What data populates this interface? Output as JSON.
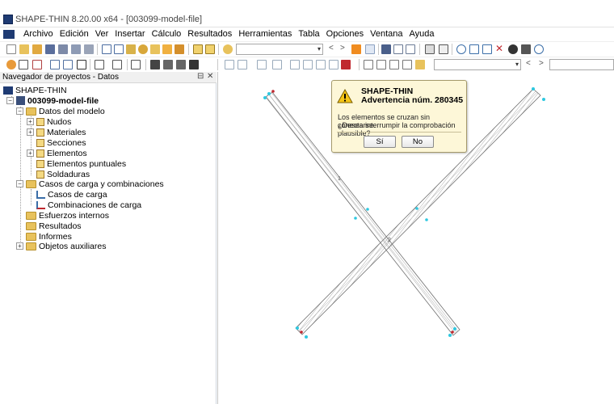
{
  "window": {
    "title": "SHAPE-THIN 8.20.00 x64 - [003099-model-file]"
  },
  "menu": {
    "items": [
      "Archivo",
      "Edición",
      "Ver",
      "Insertar",
      "Cálculo",
      "Resultados",
      "Herramientas",
      "Tabla",
      "Opciones",
      "Ventana",
      "Ayuda"
    ]
  },
  "navigator": {
    "title": "Navegador de proyectos - Datos",
    "pin_icon": "pin-icon",
    "close_icon": "close-icon",
    "tree": {
      "root": "SHAPE-THIN",
      "project": "003099-model-file",
      "model_data": "Datos del modelo",
      "nodes": "Nudos",
      "materials": "Materiales",
      "sections": "Secciones",
      "elements": "Elementos",
      "point_elements": "Elementos puntuales",
      "welds": "Soldaduras",
      "load_cases_combos": "Casos de carga y combinaciones",
      "load_cases": "Casos de carga",
      "load_combos": "Combinaciones de carga",
      "internal_forces": "Esfuerzos internos",
      "results": "Resultados",
      "reports": "Informes",
      "aux_objects": "Objetos auxiliares"
    }
  },
  "dialog": {
    "title": "SHAPE-THIN",
    "subtitle": "Advertencia núm. 280345",
    "message_line1": "Los elementos se cruzan sin conectarse.",
    "message_line2": "¿Desea interrumpir la comprobación plausible?",
    "yes_label": "Sí",
    "no_label": "No",
    "icon": "warning-icon"
  },
  "colors": {
    "accent": "#1f3b73",
    "folder": "#e8c25c",
    "dialog_bg": "#fdf7d8",
    "node": "#2ec8e0",
    "node_end": "#c0282f",
    "element_line": "#707070"
  }
}
